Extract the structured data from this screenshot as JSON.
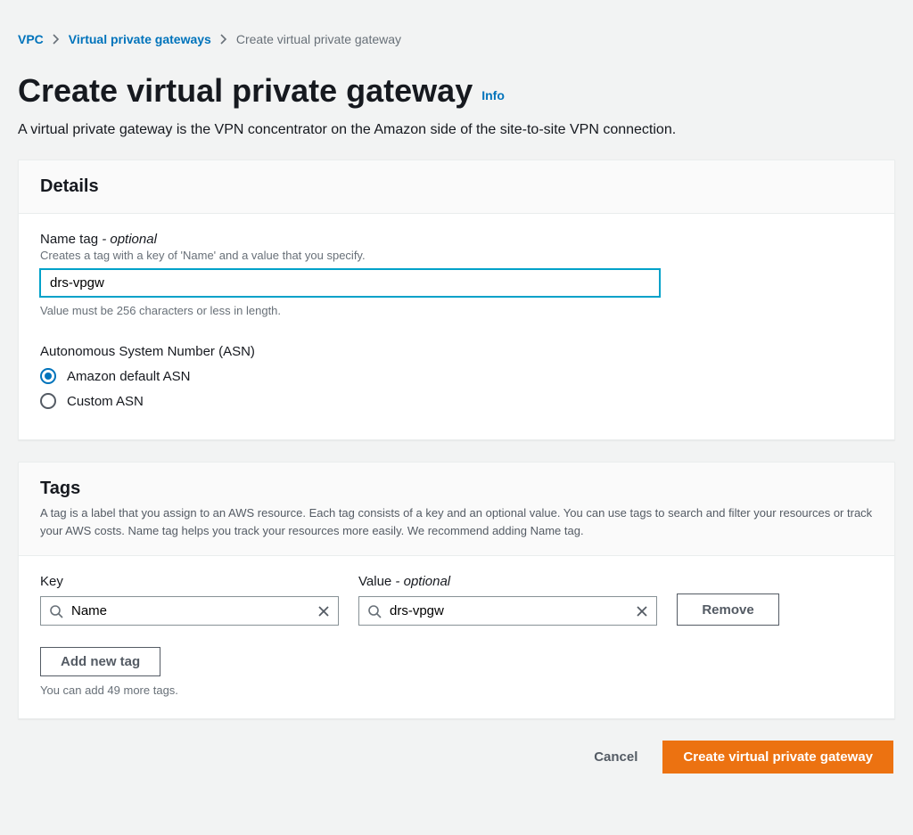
{
  "breadcrumb": {
    "root": "VPC",
    "parent": "Virtual private gateways",
    "current": "Create virtual private gateway"
  },
  "page": {
    "title": "Create virtual private gateway",
    "info_label": "Info",
    "subtitle": "A virtual private gateway is the VPN concentrator on the Amazon side of the site-to-site VPN connection."
  },
  "details": {
    "header": "Details",
    "name_tag": {
      "label": "Name tag",
      "optional_suffix": " - optional",
      "help": "Creates a tag with a key of 'Name' and a value that you specify.",
      "value": "drs-vpgw",
      "constraint": "Value must be 256 characters or less in length."
    },
    "asn": {
      "label": "Autonomous System Number (ASN)",
      "options": {
        "default": "Amazon default ASN",
        "custom": "Custom ASN"
      },
      "selected": "default"
    }
  },
  "tags": {
    "header": "Tags",
    "desc": "A tag is a label that you assign to an AWS resource. Each tag consists of a key and an optional value. You can use tags to search and filter your resources or track your AWS costs. Name tag helps you track your resources more easily. We recommend adding Name tag.",
    "key_label": "Key",
    "value_label": "Value",
    "value_optional_suffix": " - optional",
    "rows": [
      {
        "key": "Name",
        "value": "drs-vpgw"
      }
    ],
    "remove_label": "Remove",
    "add_label": "Add new tag",
    "remaining": "You can add 49 more tags."
  },
  "footer": {
    "cancel": "Cancel",
    "submit": "Create virtual private gateway"
  }
}
